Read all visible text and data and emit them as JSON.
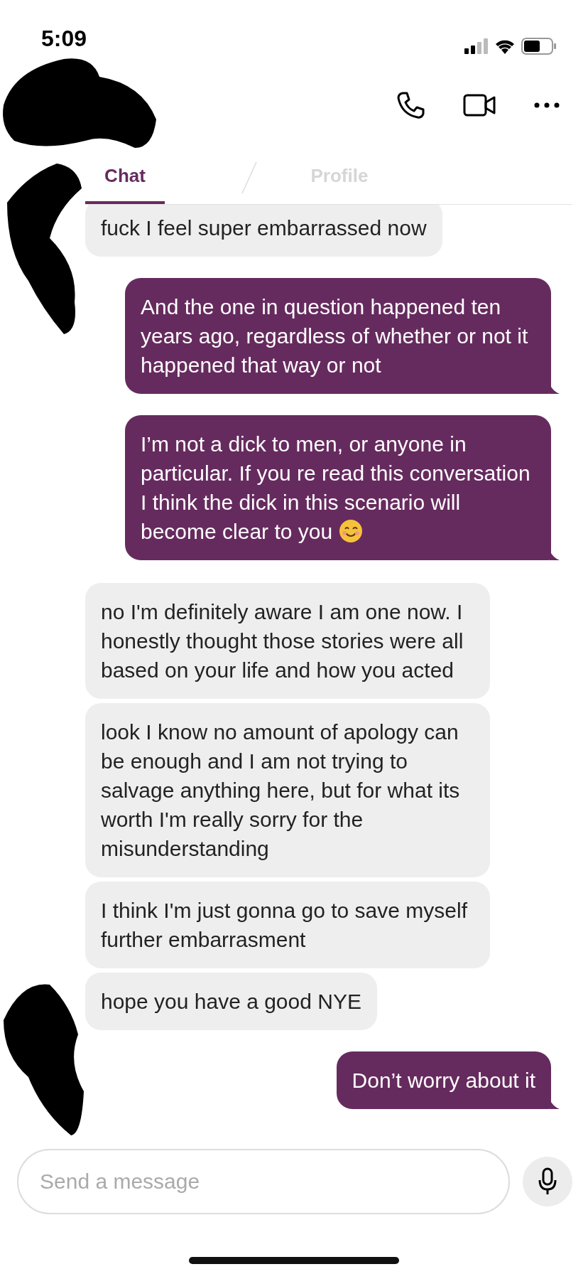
{
  "status_bar": {
    "time": "5:09"
  },
  "tabs": [
    {
      "label": "Chat",
      "selected": true
    },
    {
      "label": "Profile",
      "selected": false
    }
  ],
  "messages": [
    {
      "kind": "received",
      "text": "fuck I feel super embarrassed now"
    },
    {
      "kind": "sent",
      "text": "And the one in question happened ten years ago, regardless of whether or not it happened that way or not"
    },
    {
      "kind": "sent",
      "text": "I’m not a dick to men, or anyone in particular. If you re read this conversation I think the dick in this scenario will become clear to you",
      "trailing_emoji": true
    },
    {
      "kind": "received",
      "text": "no I'm definitely aware I am one now. I honestly thought those stories were all based on your life and how you acted"
    },
    {
      "kind": "received",
      "text": "look I know no amount of apology can be enough and I am not trying to salvage anything here, but for what its worth I'm really sorry for the misunderstanding"
    },
    {
      "kind": "received",
      "text": "I think I'm just gonna go to save myself further embarrasment"
    },
    {
      "kind": "received",
      "text": "hope you have a good NYE"
    },
    {
      "kind": "sent",
      "text": "Don’t worry about it"
    }
  ],
  "composer": {
    "placeholder": "Send a message"
  }
}
